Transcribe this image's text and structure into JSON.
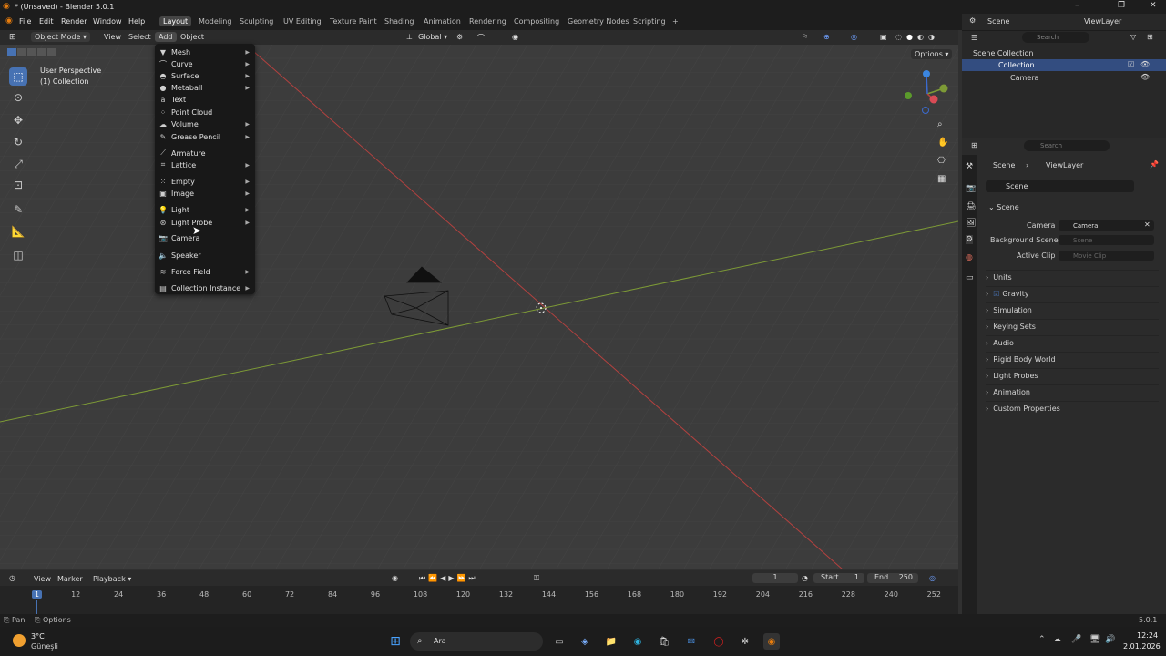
{
  "window": {
    "title": "* (Unsaved) - Blender 5.0.1",
    "minimize": "–",
    "maximize": "❐",
    "close": "✕"
  },
  "menubar": {
    "items": [
      "File",
      "Edit",
      "Render",
      "Window",
      "Help"
    ],
    "workspaces": [
      "Layout",
      "Modeling",
      "Sculpting",
      "UV Editing",
      "Texture Paint",
      "Shading",
      "Animation",
      "Rendering",
      "Compositing",
      "Geometry Nodes",
      "Scripting"
    ],
    "active_workspace": "Layout",
    "add_workspace": "+"
  },
  "viewport_header": {
    "mode": "Object Mode",
    "menus": [
      "View",
      "Select",
      "Add",
      "Object"
    ],
    "active_menu": "Add",
    "transform_orientation": "Global",
    "options": "Options"
  },
  "viewport": {
    "perspective_label": "User Perspective",
    "collection_label": "(1) Collection"
  },
  "add_menu": {
    "items": [
      {
        "label": "Mesh",
        "icon": "mesh-icon",
        "submenu": true
      },
      {
        "label": "Curve",
        "icon": "curve-icon",
        "submenu": true
      },
      {
        "label": "Surface",
        "icon": "surface-icon",
        "submenu": true
      },
      {
        "label": "Metaball",
        "icon": "metaball-icon",
        "submenu": true
      },
      {
        "label": "Text",
        "icon": "text-icon",
        "submenu": false
      },
      {
        "label": "Point Cloud",
        "icon": "point-cloud-icon",
        "submenu": false
      },
      {
        "label": "Volume",
        "icon": "volume-icon",
        "submenu": true
      },
      {
        "label": "Grease Pencil",
        "icon": "grease-pencil-icon",
        "submenu": true
      },
      {
        "label": "Armature",
        "icon": "armature-icon",
        "submenu": false
      },
      {
        "label": "Lattice",
        "icon": "lattice-icon",
        "submenu": true
      },
      {
        "label": "Empty",
        "icon": "empty-icon",
        "submenu": true
      },
      {
        "label": "Image",
        "icon": "image-icon",
        "submenu": true
      },
      {
        "label": "Light",
        "icon": "light-icon",
        "submenu": true
      },
      {
        "label": "Light Probe",
        "icon": "light-probe-icon",
        "submenu": true
      },
      {
        "label": "Camera",
        "icon": "camera-icon",
        "submenu": false
      },
      {
        "label": "Speaker",
        "icon": "speaker-icon",
        "submenu": false
      },
      {
        "label": "Force Field",
        "icon": "force-field-icon",
        "submenu": true
      },
      {
        "label": "Collection Instance",
        "icon": "collection-instance-icon",
        "submenu": true
      }
    ]
  },
  "outliner": {
    "scene": "Scene",
    "view_layer": "ViewLayer",
    "search_placeholder": "Search",
    "tree": [
      {
        "label": "Scene Collection",
        "depth": 0
      },
      {
        "label": "Collection",
        "depth": 1
      },
      {
        "label": "Camera",
        "depth": 2
      }
    ]
  },
  "properties": {
    "search_placeholder": "Search",
    "breadcrumb": [
      "Scene",
      "ViewLayer"
    ],
    "datablock": "Scene",
    "panel_title": "Scene",
    "camera_label": "Camera",
    "camera_value": "Camera",
    "background_scene_label": "Background Scene",
    "background_scene_placeholder": "Scene",
    "active_clip_label": "Active Clip",
    "active_clip_placeholder": "Movie Clip",
    "sections": [
      "Units",
      "Gravity",
      "Simulation",
      "Keying Sets",
      "Audio",
      "Rigid Body World",
      "Light Probes",
      "Animation",
      "Custom Properties"
    ]
  },
  "timeline": {
    "menus": [
      "View",
      "Marker",
      "Playback"
    ],
    "current_frame": "1",
    "start_label": "Start",
    "start_value": "1",
    "end_label": "End",
    "end_value": "250",
    "frame_ticks": [
      "1",
      "12",
      "24",
      "36",
      "48",
      "60",
      "72",
      "84",
      "96",
      "108",
      "120",
      "132",
      "144",
      "156",
      "168",
      "180",
      "192",
      "204",
      "216",
      "228",
      "240",
      "252"
    ]
  },
  "statusbar": {
    "left_label": "Pan",
    "options_label": "Options",
    "version": "5.0.1"
  },
  "taskbar": {
    "weather_temp": "3°C",
    "weather_desc": "Güneşli",
    "search_label": "Ara",
    "time": "12:24",
    "date": "2.01.2026"
  },
  "colors": {
    "accent": "#4772b3",
    "x_axis": "#b3413f",
    "y_axis": "#7d9a36"
  }
}
